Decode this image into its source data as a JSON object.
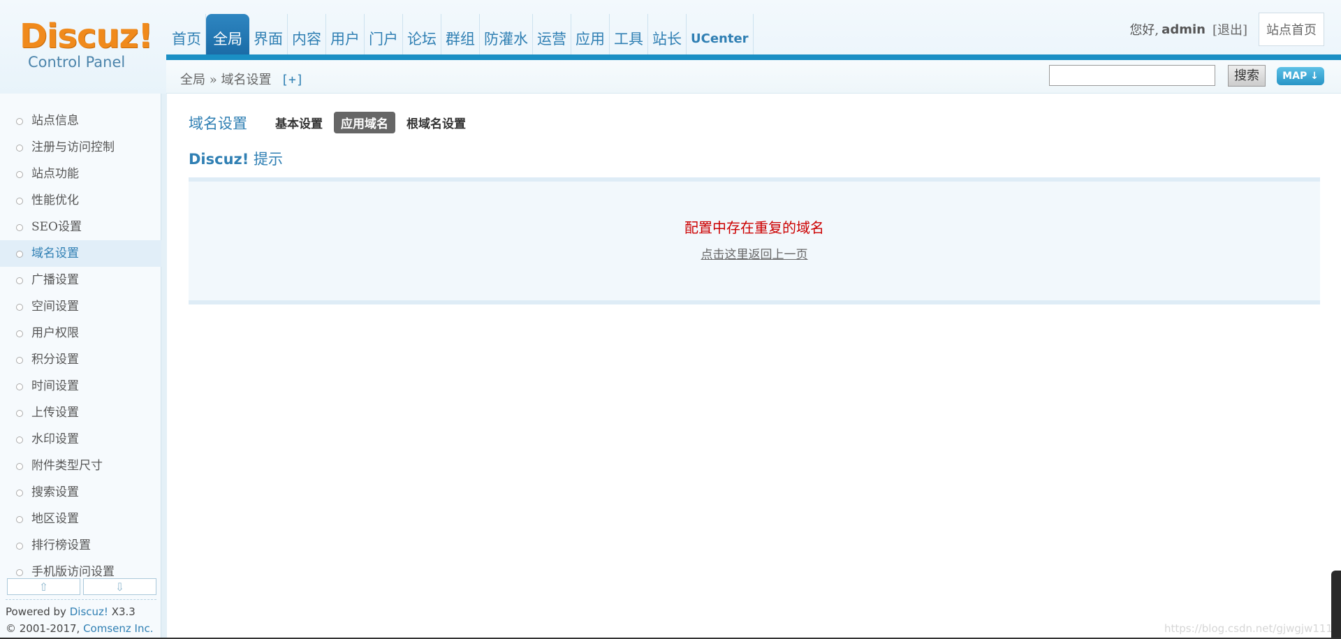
{
  "header": {
    "logo_brand": "Discuz!",
    "logo_sub": "Control Panel",
    "nav": [
      "首页",
      "全局",
      "界面",
      "内容",
      "用户",
      "门户",
      "论坛",
      "群组",
      "防灌水",
      "运营",
      "应用",
      "工具",
      "站长",
      "UCenter"
    ],
    "active_nav": "全局",
    "greeting": "您好,",
    "username": "admin",
    "logout": "[退出]",
    "site_home": "站点首页"
  },
  "breadcrumb": {
    "root": "全局",
    "sep": "»",
    "current": "域名设置",
    "plus": "[+]"
  },
  "search": {
    "button": "搜索",
    "value": ""
  },
  "map_button": "MAP ↓",
  "sidebar": {
    "items": [
      "站点信息",
      "注册与访问控制",
      "站点功能",
      "性能优化",
      "SEO设置",
      "域名设置",
      "广播设置",
      "空间设置",
      "用户权限",
      "积分设置",
      "时间设置",
      "上传设置",
      "水印设置",
      "附件类型尺寸",
      "搜索设置",
      "地区设置",
      "排行榜设置",
      "手机版访问设置"
    ],
    "active": "域名设置",
    "scroll_up": "⇧",
    "scroll_down": "⇩",
    "powered_prefix": "Powered by",
    "powered_brand": "Discuz!",
    "powered_version": "X3.3",
    "copyright_prefix": "© 2001-2017,",
    "copyright_company": "Comsenz Inc."
  },
  "main": {
    "title": "域名设置",
    "tabs": [
      "基本设置",
      "应用域名",
      "根域名设置"
    ],
    "current_tab": "应用域名",
    "tip_brand": "Discuz!",
    "tip_label": "提示",
    "message": "配置中存在重复的域名",
    "back_link": "点击这里返回上一页"
  },
  "watermark": "https://blog.csdn.net/gjwgjw111",
  "colors": {
    "accent": "#2f7fb3",
    "nav_active": "#1a6aa5",
    "logo": "#f08a1c",
    "error": "#cc0000"
  }
}
